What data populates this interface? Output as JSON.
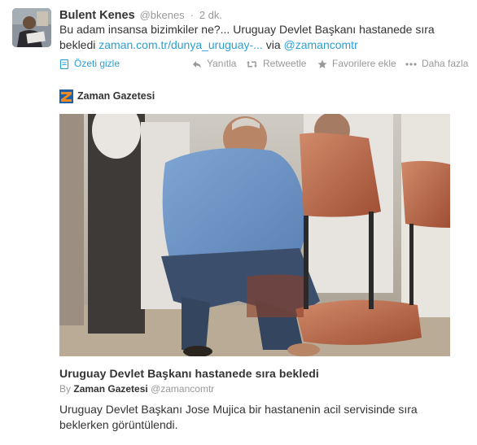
{
  "tweet": {
    "fullname": "Bulent Kenes",
    "username": "@bkenes",
    "separator": "·",
    "time": "2 dk.",
    "text_part1": "Bu adam insansa bizimkiler ne?... Uruguay Devlet Başkanı hastanede sıra bekledi",
    "link": "zaman.com.tr/dunya_uruguay-...",
    "via_label": "via",
    "mention": "@zamancomtr"
  },
  "actions": {
    "summary": "Özeti gizle",
    "reply": "Yanıtla",
    "retweet": "Retweetle",
    "favorite": "Favorilere ekle",
    "more": "Daha fazla"
  },
  "card": {
    "source": "Zaman Gazetesi",
    "title": "Uruguay Devlet Başkanı hastanede sıra bekledi",
    "by_label": "By",
    "by_name": "Zaman Gazetesi",
    "by_handle": "@zamancomtr",
    "description": "Uruguay Devlet Başkanı Jose Mujica bir hastanenin acil servisinde sıra beklerken görüntülendi."
  },
  "colors": {
    "link": "#2a9fd6",
    "muted": "#999999",
    "text": "#333333",
    "chair": "#b8684a"
  },
  "icons": {
    "summary": "card-summary-icon",
    "reply": "reply-icon",
    "retweet": "retweet-icon",
    "favorite": "star-icon",
    "more": "more-dots-icon",
    "source_logo": "zaman-logo-icon"
  }
}
